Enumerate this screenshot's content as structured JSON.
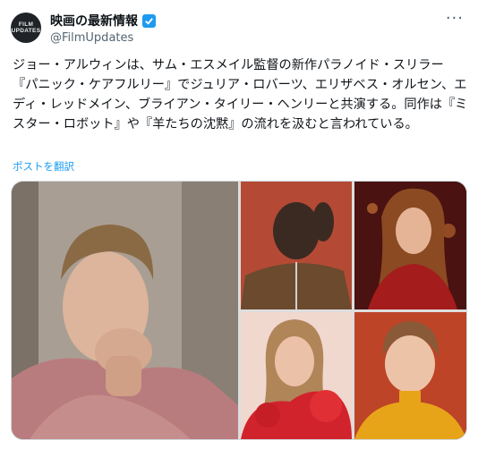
{
  "account": {
    "avatar_text_1": "FILM",
    "avatar_text_2": "UPDATES",
    "display_name": "映画の最新情報",
    "handle": "@FilmUpdates",
    "more_icon": "more-horizontal-icon"
  },
  "post": {
    "text": "ジョー・アルウィンは、サム・エスメイル監督の新作パラノイド・スリラー『パニック・ケアフルリー』でジュリア・ロバーツ、エリザベス・オルセン、エディ・レッドメイン、ブライアン・タイリー・ヘンリーと共演する。同作は『ミスター・ロボット』や『羊たちの沈黙』の流れを汲むと言われている。",
    "translate_label": "ポストを翻訳"
  },
  "media": {
    "photos": [
      {
        "subject": "man in pink sweater, hand on chin"
      },
      {
        "subject": "man in brown shirt with chain"
      },
      {
        "subject": "woman in red sequin jacket"
      },
      {
        "subject": "woman in red ruffled top"
      },
      {
        "subject": "man in yellow sweater"
      }
    ]
  },
  "colors": {
    "accent": "#1d9bf0",
    "secondary_text": "#536471"
  }
}
